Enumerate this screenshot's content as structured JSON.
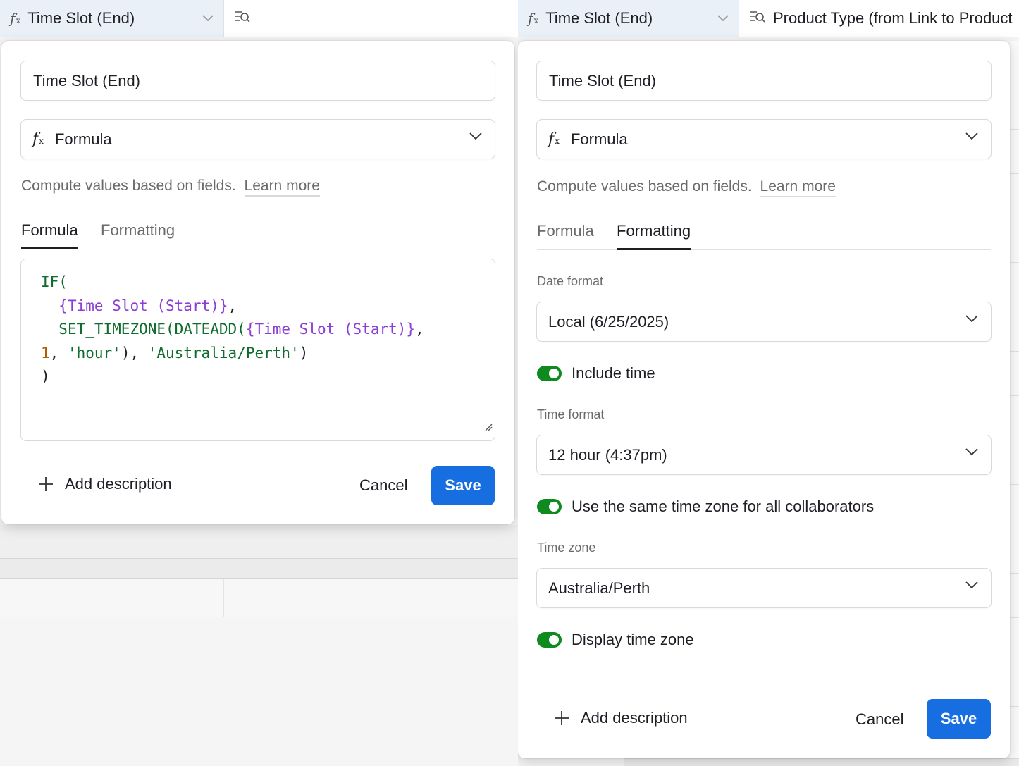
{
  "left": {
    "header": {
      "col1_label": "Time Slot (End)",
      "col2_label": ""
    },
    "dialog": {
      "field_name": "Time Slot (End)",
      "field_type": "Formula",
      "helper_text": "Compute values based on fields.",
      "learn_more": "Learn more",
      "tab_formula": "Formula",
      "tab_formatting": "Formatting",
      "code": {
        "l1_fn": "IF(",
        "l2_field": "{Time Slot (Start)}",
        "l2_p": ",",
        "l3_fn": "SET_TIMEZONE(DATEADD(",
        "l3_field": "{Time Slot (Start)}",
        "l3_p": ",",
        "l4_num": "1",
        "l4_p1": ", ",
        "l4_str1": "'hour'",
        "l4_p2": "), ",
        "l4_str2": "'Australia/Perth'",
        "l4_p3": ")",
        "l5_p": ")"
      },
      "add_description": "Add description",
      "cancel": "Cancel",
      "save": "Save"
    }
  },
  "right": {
    "header": {
      "col1_label": "Time Slot (End)",
      "col2_label": "Product Type (from Link to Product"
    },
    "dialog": {
      "field_name": "Time Slot (End)",
      "field_type": "Formula",
      "helper_text": "Compute values based on fields.",
      "learn_more": "Learn more",
      "tab_formula": "Formula",
      "tab_formatting": "Formatting",
      "date_format_label": "Date format",
      "date_format_value": "Local (6/25/2025)",
      "include_time_label": "Include time",
      "include_time_on": true,
      "time_format_label": "Time format",
      "time_format_value": "12 hour (4:37pm)",
      "same_tz_label": "Use the same time zone for all collaborators",
      "same_tz_on": true,
      "time_zone_label": "Time zone",
      "time_zone_value": "Australia/Perth",
      "display_tz_label": "Display time zone",
      "display_tz_on": true,
      "add_description": "Add description",
      "cancel": "Cancel",
      "save": "Save"
    }
  },
  "colors": {
    "accent": "#166ee1",
    "toggle_on": "#0f8a1f",
    "code_fn": "#0f6b2e",
    "code_field": "#8a3ed6",
    "code_num": "#b35c00"
  }
}
